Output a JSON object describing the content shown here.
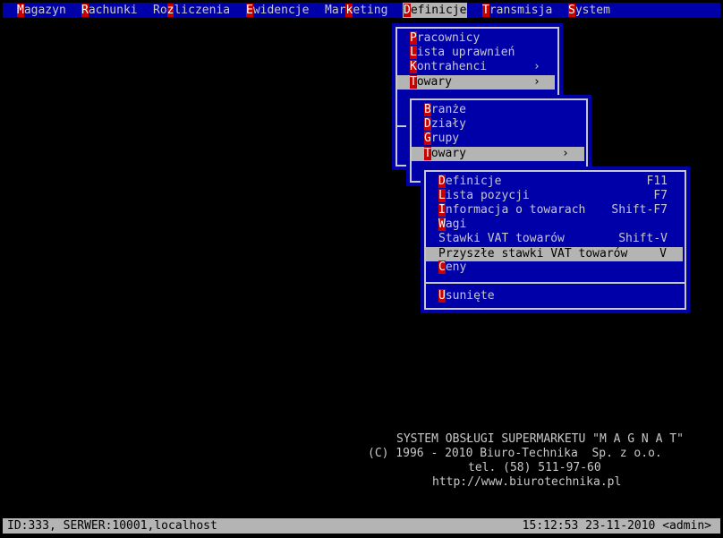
{
  "menubar": [
    {
      "hk": "M",
      "rest": "agazyn"
    },
    {
      "hk": "R",
      "rest": "achunki"
    },
    {
      "pre": "Ro",
      "hk": "z",
      "rest": "liczenia"
    },
    {
      "hk": "E",
      "rest": "widencje"
    },
    {
      "pre": "Mar",
      "hk": "k",
      "rest": "eting"
    },
    {
      "hk": "D",
      "rest": "efinicje"
    },
    {
      "hk": "T",
      "rest": "ransmisja"
    },
    {
      "hk": "S",
      "rest": "ystem"
    }
  ],
  "menu1": [
    {
      "hk": "P",
      "rest": "racownicy"
    },
    {
      "hk": "L",
      "rest": "ista uprawnień"
    },
    {
      "hk": "K",
      "rest": "ontrahenci",
      "arrow": "›"
    },
    {
      "hk": "T",
      "rest": "owary",
      "arrow": "›"
    }
  ],
  "menu2": [
    {
      "hk": "B",
      "rest": "ranże"
    },
    {
      "hk": "D",
      "rest": "ziały"
    },
    {
      "hk": "G",
      "rest": "rupy"
    },
    {
      "hk": "T",
      "rest": "owary",
      "arrow": "›"
    }
  ],
  "menu3": [
    {
      "hk": "D",
      "rest": "efinicje",
      "key": "F11"
    },
    {
      "hk": "L",
      "rest": "ista pozycji",
      "key": "F7"
    },
    {
      "hk": "I",
      "rest": "nformacja o towarach",
      "key": "Shift-F7"
    },
    {
      "hk": "W",
      "rest": "agi",
      "key": ""
    },
    {
      "hk": "",
      "rest": "Stawki VAT towarów",
      "key": "Shift-V"
    },
    {
      "hk": "",
      "rest": "Przyszłe stawki VAT towarów",
      "key": "V"
    },
    {
      "hk": "C",
      "rest": "eny",
      "key": ""
    },
    {
      "hk": "U",
      "rest": "sunięte",
      "key": ""
    }
  ],
  "info": {
    "line1": "SYSTEM OBSŁUGI SUPERMARKETU \"M A G N A T\"",
    "line2": "(C) 1996 - 2010 Biuro-Technika  Sp. z o.o.",
    "line3": "tel. (58) 511-97-60",
    "line4": "http://www.biurotechnika.pl"
  },
  "status": {
    "left": "ID:333, SERWER:10001,localhost",
    "right": "15:12:53 23-11-2010 <admin>"
  }
}
